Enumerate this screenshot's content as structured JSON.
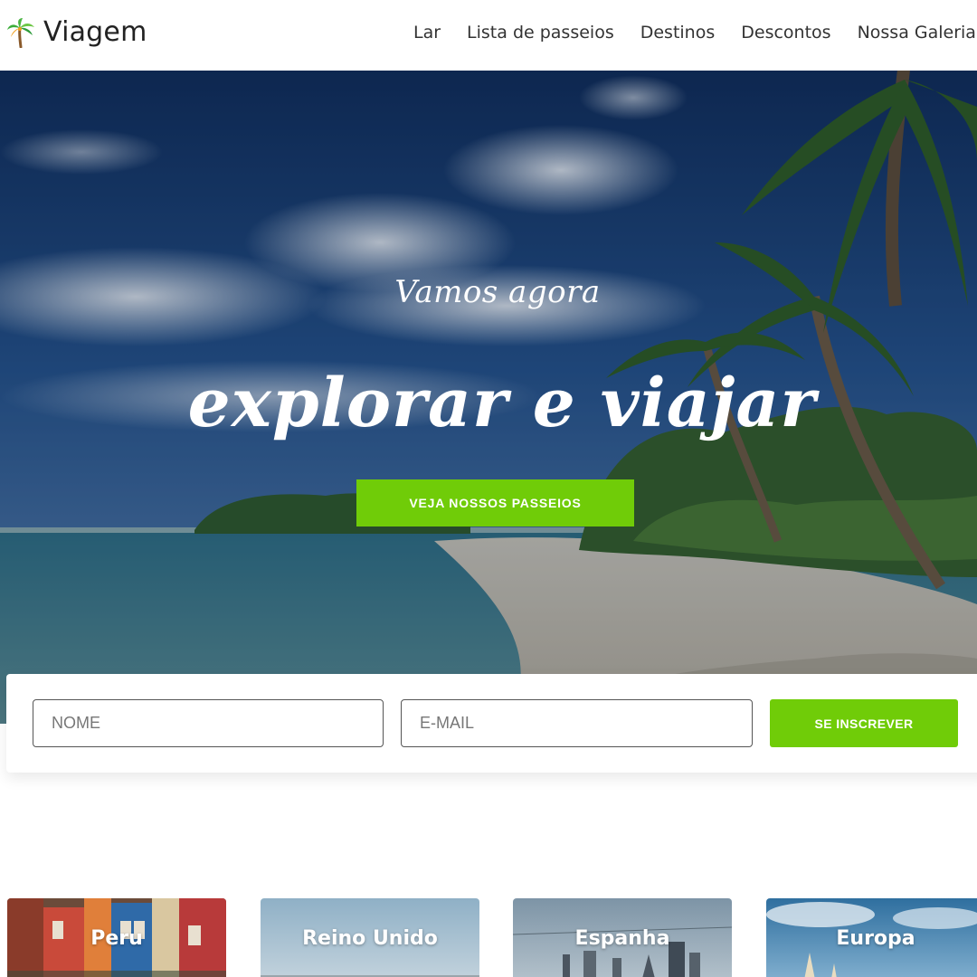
{
  "brand": {
    "name": "Viagem",
    "logo_icon": "palm-tree-icon"
  },
  "nav": {
    "items": [
      {
        "label": "Lar"
      },
      {
        "label": "Lista de passeios"
      },
      {
        "label": "Destinos"
      },
      {
        "label": "Descontos"
      },
      {
        "label": "Nossa Galeria"
      }
    ]
  },
  "hero": {
    "tagline": "Vamos agora",
    "headline": "explorar e viajar",
    "cta_label": "VEJA NOSSOS PASSEIOS"
  },
  "subscribe": {
    "name_placeholder": "NOME",
    "email_placeholder": "E-MAIL",
    "button_label": "SE INSCREVER"
  },
  "destinations": [
    {
      "name": "Peru"
    },
    {
      "name": "Reino Unido"
    },
    {
      "name": "Espanha"
    },
    {
      "name": "Europa"
    }
  ],
  "colors": {
    "accent": "#70cc08",
    "text": "#222222",
    "white": "#ffffff"
  }
}
